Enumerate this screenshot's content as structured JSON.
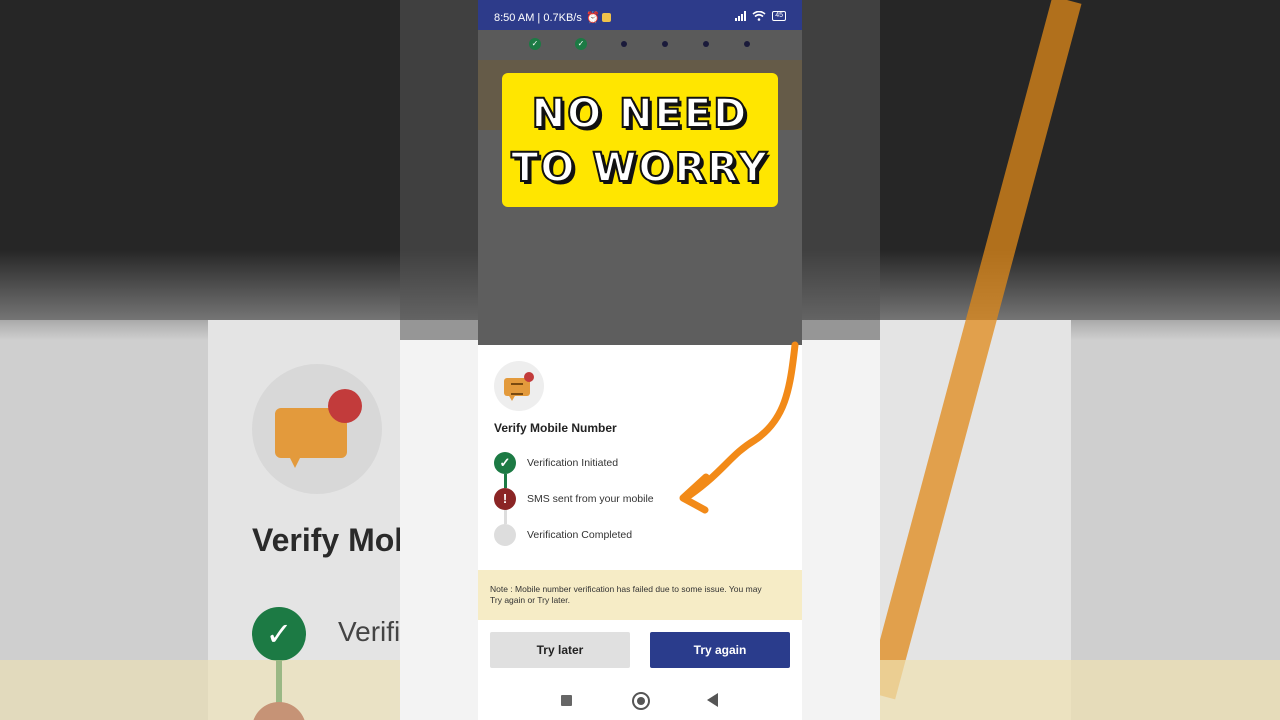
{
  "status_bar": {
    "time": "8:50 AM | 0.7KB/s",
    "battery": "45"
  },
  "progress_steps": {
    "done": 2,
    "total": 6
  },
  "overlay": {
    "line1": "NO NEED",
    "line2": "TO WORRY"
  },
  "sheet": {
    "title": "Verify Mobile Number",
    "steps": [
      {
        "label": "Verification Initiated",
        "state": "done",
        "icon": "check-icon"
      },
      {
        "label": "SMS sent from your mobile",
        "state": "error",
        "icon": "exclamation-icon"
      },
      {
        "label": "Verification Completed",
        "state": "pending",
        "icon": "pending-dot"
      }
    ],
    "note": "Note : Mobile number verification has failed due to some issue. You may Try again or Try later.",
    "buttons": {
      "later": "Try later",
      "again": "Try again"
    }
  },
  "background": {
    "title": "Verify Mob",
    "step_label": "Verifi"
  },
  "colors": {
    "status_bar": "#2d3b8a",
    "primary_button": "#2a3c8c",
    "success": "#1c7a44",
    "error": "#8b2525",
    "note_bg": "#f6ecc6",
    "overlay": "#ffe600",
    "arrow": "#f28a18"
  }
}
